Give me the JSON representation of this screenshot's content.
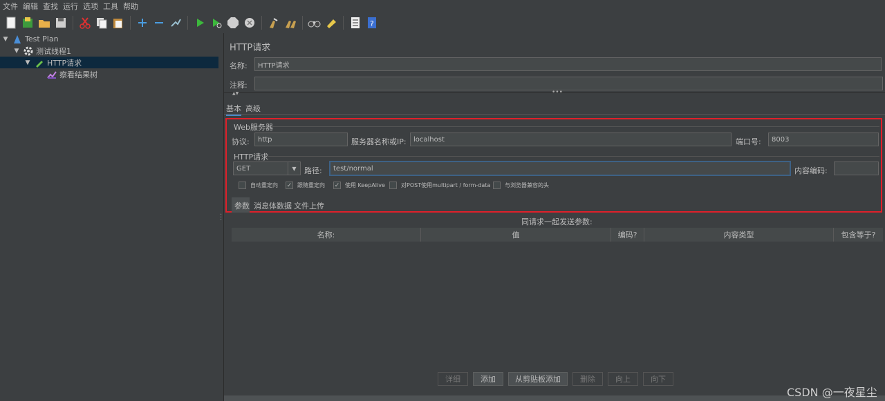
{
  "menu": [
    "文件",
    "编辑",
    "查找",
    "运行",
    "选项",
    "工具",
    "帮助"
  ],
  "tree": {
    "items": [
      {
        "label": "Test Plan"
      },
      {
        "label": "测试线程1"
      },
      {
        "label": "HTTP请求"
      },
      {
        "label": "察看结果树"
      }
    ]
  },
  "panel": {
    "title": "HTTP请求",
    "name_label": "名称:",
    "name_value": "HTTP请求",
    "comment_label": "注释:",
    "comment_value": "",
    "tabs": [
      "基本",
      "高级"
    ],
    "web_server": {
      "group_title": "Web服务器",
      "protocol_label": "协议:",
      "protocol_value": "http",
      "server_label": "服务器名称或IP:",
      "server_value": "localhost",
      "port_label": "端口号:",
      "port_value": "8003"
    },
    "http_request": {
      "group_title": "HTTP请求",
      "method_value": "GET",
      "path_label": "路径:",
      "path_value": "test/normal",
      "encoding_label": "内容编码:",
      "encoding_value": ""
    },
    "checkboxes": [
      {
        "label": "自动重定向",
        "checked": false
      },
      {
        "label": "跟随重定向",
        "checked": true
      },
      {
        "label": "使用 KeepAlive",
        "checked": true
      },
      {
        "label": "对POST使用multipart / form-data",
        "checked": false
      },
      {
        "label": "与浏览器兼容的头",
        "checked": false
      }
    ],
    "sub_tabs": [
      "参数",
      "消息体数据",
      "文件上传"
    ],
    "params_caption": "同请求一起发送参数:",
    "table_headers": [
      "名称:",
      "值",
      "编码?",
      "内容类型",
      "包含等于?"
    ],
    "buttons": [
      {
        "label": "详细",
        "enabled": false
      },
      {
        "label": "添加",
        "enabled": true
      },
      {
        "label": "从剪贴板添加",
        "enabled": true
      },
      {
        "label": "删除",
        "enabled": false
      },
      {
        "label": "向上",
        "enabled": false
      },
      {
        "label": "向下",
        "enabled": false
      }
    ]
  },
  "watermark": "CSDN @一夜星尘",
  "colors": {
    "background": "#3c3f41",
    "selection": "#0d293e",
    "highlight_box": "#e0202a",
    "focus_border": "#3d6185"
  }
}
